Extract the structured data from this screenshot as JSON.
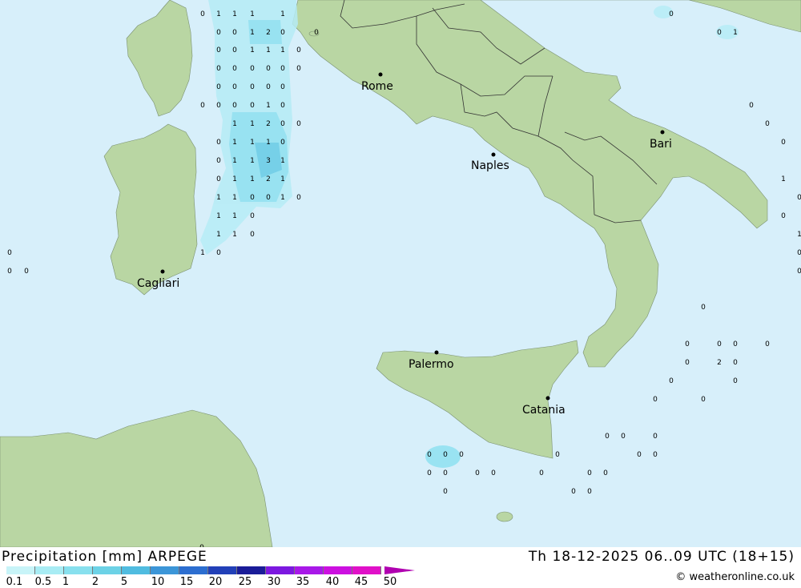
{
  "title": "Precipitation [mm] ARPEGE",
  "datetime": "Th 18-12-2025 06..09 UTC (18+15)",
  "copyright": "© weatheronline.co.uk",
  "cities": [
    "Rome",
    "Naples",
    "Bari",
    "Cagliari",
    "Palermo",
    "Catania"
  ],
  "legend": {
    "labels": [
      "0.1",
      "0.5",
      "1",
      "2",
      "5",
      "10",
      "15",
      "20",
      "25",
      "30",
      "35",
      "40",
      "45",
      "50"
    ],
    "colors": [
      "#c8f4f8",
      "#a8ecf4",
      "#88e0ee",
      "#6cd2e6",
      "#50bce0",
      "#3c96d8",
      "#2c6ed0",
      "#2240b8",
      "#1a1c98",
      "#7c18e0",
      "#a818e8",
      "#cc10e0",
      "#e010c8",
      "#b000b0"
    ]
  },
  "map_colors": {
    "sea": "#d7effa",
    "land": "#b9d6a3",
    "rain_light": "#b6ecf6",
    "rain_mid": "#8ee0f0",
    "rain_heavy": "#66cbe6"
  },
  "precip_values": [
    "0",
    "1",
    "1",
    "1",
    "1",
    "0",
    "0",
    "1",
    "2",
    "0",
    "0",
    "0",
    "0",
    "1",
    "1",
    "1",
    "0",
    "0",
    "0",
    "0",
    "0",
    "0",
    "0",
    "0",
    "0",
    "0",
    "0",
    "0",
    "0",
    "0",
    "0",
    "0",
    "1",
    "0",
    "1",
    "1",
    "2",
    "0",
    "0",
    "0",
    "1",
    "1",
    "1",
    "0",
    "0",
    "1",
    "1",
    "3",
    "1",
    "0",
    "1",
    "1",
    "2",
    "1",
    "1",
    "1",
    "0",
    "0",
    "1",
    "0",
    "1",
    "1",
    "0",
    "1",
    "1",
    "0",
    "1",
    "0",
    "0",
    "0",
    "0",
    "0",
    "0",
    "1",
    "0",
    "0",
    "0",
    "1",
    "0",
    "0",
    "1",
    "0",
    "0",
    "0",
    "0",
    "0",
    "0",
    "0",
    "0",
    "2",
    "0",
    "0",
    "0",
    "0",
    "0",
    "0",
    "0",
    "0",
    "0",
    "0",
    "0",
    "0",
    "0",
    "0",
    "0",
    "0",
    "0",
    "0",
    "0",
    "0",
    "0",
    "0",
    "0",
    "0",
    "0",
    "0",
    "0"
  ]
}
